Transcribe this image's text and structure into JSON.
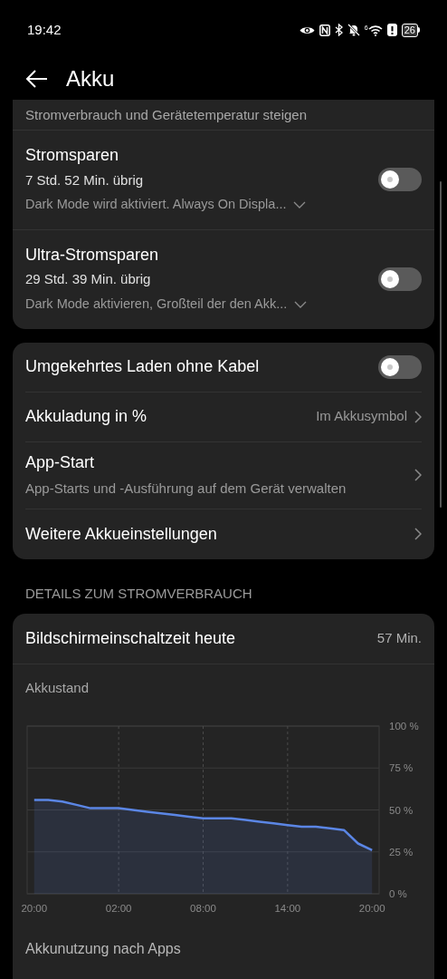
{
  "status_bar": {
    "time": "19:42",
    "battery": "26",
    "signal_mark": "6"
  },
  "header": {
    "title": "Akku"
  },
  "partial_card": {
    "text": "Stromverbrauch und Gerätetemperatur steigen"
  },
  "power_modes": [
    {
      "title": "Stromsparen",
      "remaining": "7 Std. 52 Min. übrig",
      "description": "Dark Mode wird aktiviert. Always On Displa...",
      "on": false
    },
    {
      "title": "Ultra-Stromsparen",
      "remaining": "29 Std. 39 Min. übrig",
      "description": "Dark Mode aktivieren, Großteil der den Akk...",
      "on": false
    }
  ],
  "settings": [
    {
      "kind": "toggle",
      "label": "Umgekehrtes Laden ohne Kabel",
      "on": false
    },
    {
      "kind": "value",
      "label": "Akkuladung in %",
      "value": "Im Akkusymbol"
    },
    {
      "kind": "link",
      "label": "App-Start",
      "subtitle": "App-Starts und -Ausführung auf dem Gerät verwalten"
    },
    {
      "kind": "link",
      "label": "Weitere Akkueinstellungen"
    }
  ],
  "details": {
    "heading": "DETAILS ZUM STROMVERBRAUCH",
    "screen_time": {
      "label": "Bildschirmeinschaltzeit heute",
      "value": "57 Min."
    },
    "chart_data": {
      "type": "area",
      "title": "Akkustand",
      "categories": [
        "20:00",
        null,
        null,
        null,
        null,
        null,
        "02:00",
        null,
        null,
        null,
        null,
        null,
        "08:00",
        null,
        null,
        null,
        null,
        null,
        "14:00",
        null,
        null,
        null,
        null,
        null,
        "20:00"
      ],
      "series": [
        {
          "color": "#5b86e5",
          "values": [
            56,
            56,
            55,
            53,
            51,
            51,
            51,
            50,
            49,
            48,
            47,
            46,
            45,
            45,
            45,
            44,
            43,
            42,
            41,
            40,
            40,
            39,
            38,
            30,
            26
          ]
        }
      ],
      "ylim": [
        0,
        100
      ],
      "grid": true,
      "yticks": [
        {
          "value": 0,
          "label": "0 %"
        },
        {
          "value": 25,
          "label": "25 %"
        },
        {
          "value": 50,
          "label": "50 %"
        },
        {
          "value": 75,
          "label": "75 %"
        },
        {
          "value": 100,
          "label": "100 %"
        }
      ]
    },
    "footer": "Akkunutzung nach Apps"
  }
}
